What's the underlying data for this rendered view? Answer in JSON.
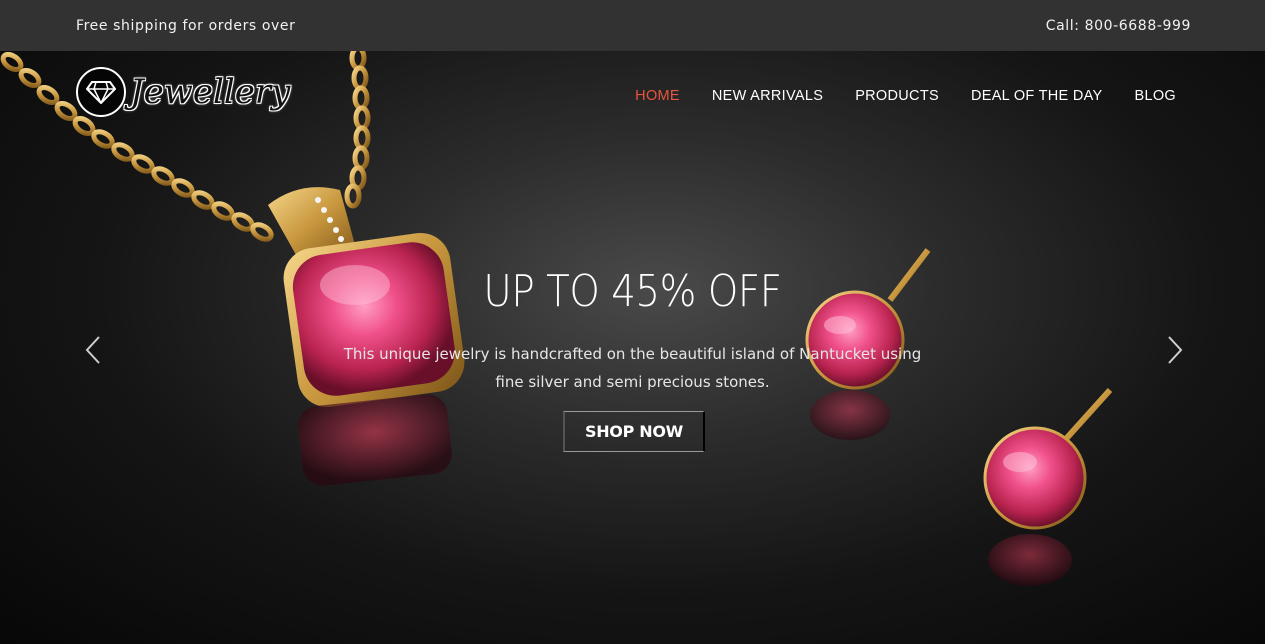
{
  "topbar": {
    "shipping_text": "Free shipping for orders over",
    "phone_text": "Call: 800-6688-999"
  },
  "brand": {
    "name": "Jewellery",
    "icon": "diamond-icon"
  },
  "nav": {
    "items": [
      {
        "label": "HOME",
        "active": true
      },
      {
        "label": "NEW ARRIVALS",
        "active": false
      },
      {
        "label": "PRODUCTS",
        "active": false
      },
      {
        "label": "DEAL OF THE DAY",
        "active": false
      },
      {
        "label": "BLOG",
        "active": false
      }
    ],
    "active_color": "#e8553f"
  },
  "hero": {
    "title": "UP TO 45% OFF",
    "description": "This unique jewelry is handcrafted on the beautiful island of Nantucket using fine silver and semi precious stones.",
    "button_label": "SHOP NOW",
    "prev_icon": "chevron-left-icon",
    "next_icon": "chevron-right-icon"
  },
  "colors": {
    "topbar_bg": "#323232",
    "gem_pink": "#f0508a",
    "gold": "#d9a84a"
  }
}
